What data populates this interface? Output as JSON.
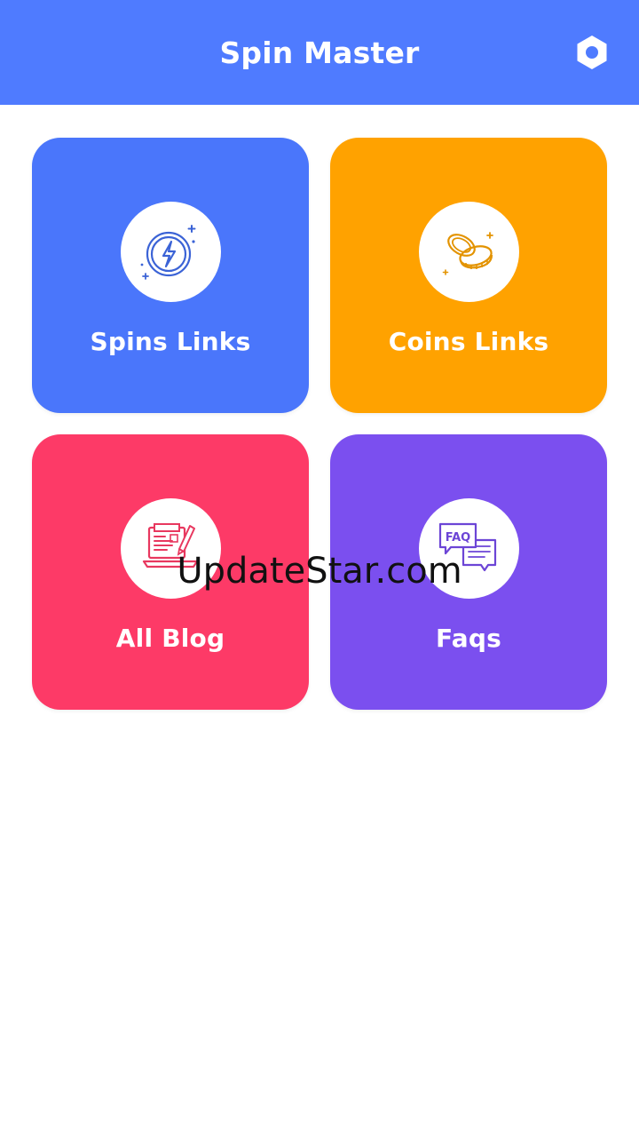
{
  "app_bar": {
    "title": "Spin Master",
    "background": "#4f7bff",
    "settings_icon": "settings-hexagon-icon"
  },
  "cards": [
    {
      "label": "Spins Links",
      "color": "#4a76fb",
      "icon": "lightning-coin-icon",
      "icon_color": "#3b63d6"
    },
    {
      "label": "Coins Links",
      "color": "#ffa200",
      "icon": "coins-icon",
      "icon_color": "#e39300"
    },
    {
      "label": "All Blog",
      "color": "#fd3a67",
      "icon": "blog-laptop-icon",
      "icon_color": "#e8385f"
    },
    {
      "label": "Faqs",
      "color": "#7b4fef",
      "icon": "faq-chat-icon",
      "icon_color": "#6c45d6",
      "icon_text": "FAQ"
    }
  ],
  "watermark": "UpdateStar.com"
}
